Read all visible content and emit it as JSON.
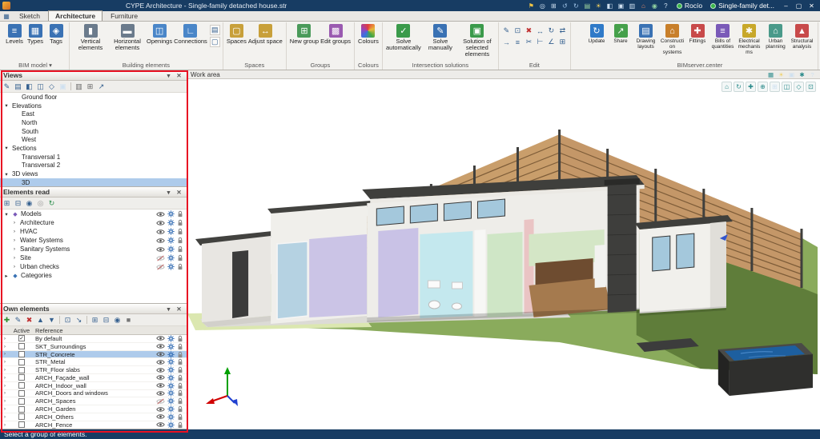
{
  "colors": {
    "titlebar": "#173c63",
    "selection": "#aecbeb",
    "annotation": "#e81123",
    "online_green": "#39b54a"
  },
  "titlebar": {
    "title": "CYPE Architecture - Single-family detached house.str",
    "quick_icons": [
      "flag-icon",
      "search-icon",
      "zoom-window-icon",
      "undo-icon",
      "redo-icon",
      "layers-icon",
      "sun-icon",
      "section-icon",
      "camera-icon",
      "printer-icon",
      "building-icon",
      "globe-icon",
      "help-icon"
    ],
    "user": "Rocío",
    "project": "Single-family det...",
    "window_buttons": [
      "minimize-button",
      "maximize-button",
      "close-button"
    ]
  },
  "tabs": [
    {
      "label": "Sketch",
      "active": false
    },
    {
      "label": "Architecture",
      "active": true
    },
    {
      "label": "Furniture",
      "active": false
    }
  ],
  "ribbon": {
    "groups": [
      {
        "label": "BIM model",
        "dropdown": true,
        "buttons": [
          {
            "label": "Levels",
            "icon": "levels-icon"
          },
          {
            "label": "Types",
            "icon": "types-icon"
          },
          {
            "label": "Tags",
            "icon": "tags-icon"
          }
        ]
      },
      {
        "label": "Building elements",
        "buttons": [
          {
            "label": "Vertical elements",
            "icon": "vertical-elements-icon"
          },
          {
            "label": "Horizontal elements",
            "icon": "horizontal-elements-icon"
          },
          {
            "label": "Openings",
            "icon": "openings-icon"
          },
          {
            "label": "Connections",
            "icon": "connections-icon"
          }
        ],
        "stack": [
          "wall-layers-icon",
          "frame-icon"
        ]
      },
      {
        "label": "Spaces",
        "buttons": [
          {
            "label": "Spaces",
            "icon": "spaces-icon"
          },
          {
            "label": "Adjust space",
            "icon": "adjust-space-icon"
          }
        ]
      },
      {
        "label": "Groups",
        "buttons": [
          {
            "label": "New group",
            "icon": "new-group-icon"
          },
          {
            "label": "Edit groups",
            "icon": "edit-groups-icon"
          }
        ]
      },
      {
        "label": "Colours",
        "buttons": [
          {
            "label": "Colours",
            "icon": "colours-icon"
          }
        ]
      },
      {
        "label": "Intersection solutions",
        "buttons": [
          {
            "label": "Solve automatically",
            "icon": "solve-auto-icon"
          },
          {
            "label": "Solve manually",
            "icon": "solve-manual-icon"
          },
          {
            "label": "Solution of selected elements",
            "icon": "solve-selected-icon"
          }
        ]
      },
      {
        "label": "Edit",
        "icons": [
          "edit-icon",
          "copy-icon",
          "delete-icon",
          "move-icon",
          "rotate-icon",
          "mirror-icon",
          "offset-icon",
          "align-icon",
          "trim-icon",
          "extend-icon",
          "measure-icon",
          "group-icon"
        ]
      },
      {
        "label": "BIMserver.center",
        "push": true,
        "compact": true,
        "buttons": [
          {
            "label": "Update",
            "icon": "update-icon"
          },
          {
            "label": "Share",
            "icon": "share-icon"
          },
          {
            "label": "Drawing layouts",
            "icon": "drawing-layouts-icon"
          },
          {
            "label": "Construction systems",
            "icon": "construction-systems-icon"
          },
          {
            "label": "Fittings",
            "icon": "fittings-icon"
          },
          {
            "label": "Bills of quantities",
            "icon": "bills-icon"
          },
          {
            "label": "Electrical mechanisms",
            "icon": "electrical-icon"
          },
          {
            "label": "Urban planning",
            "icon": "urban-planning-icon"
          },
          {
            "label": "Structural analysis",
            "icon": "structural-icon"
          }
        ]
      }
    ]
  },
  "views_panel": {
    "title": "Views",
    "toolbar": [
      "edit-view-icon",
      "floor-plan-icon",
      "elevation-icon",
      "section-view-icon",
      "view-3d-icon",
      "camera-icon",
      "sep",
      "print-icon",
      "layout-icon",
      "export-icon"
    ],
    "items": [
      {
        "label": "Ground floor",
        "level": 1
      },
      {
        "label": "Elevations",
        "level": 0,
        "expanded": true
      },
      {
        "label": "East",
        "level": 1
      },
      {
        "label": "North",
        "level": 1
      },
      {
        "label": "South",
        "level": 1
      },
      {
        "label": "West",
        "level": 1
      },
      {
        "label": "Sections",
        "level": 0,
        "expanded": true
      },
      {
        "label": "Transversal 1",
        "level": 1
      },
      {
        "label": "Transversal 2",
        "level": 1
      },
      {
        "label": "3D views",
        "level": 0,
        "expanded": true
      },
      {
        "label": "3D",
        "level": 1,
        "selected": true
      }
    ]
  },
  "elements_read_panel": {
    "title": "Elements read",
    "toolbar": [
      "expand-all-icon",
      "collapse-all-icon",
      "show-all-icon",
      "hide-all-icon",
      "refresh-icon"
    ],
    "items": [
      {
        "label": "Models",
        "level": 0,
        "expanded": true,
        "icon": "models-icon",
        "controls": true,
        "eye": true
      },
      {
        "label": "Architecture",
        "level": 1,
        "controls": true,
        "eye": true
      },
      {
        "label": "HVAC",
        "level": 1,
        "controls": true,
        "eye": true
      },
      {
        "label": "Water Systems",
        "level": 1,
        "controls": true,
        "eye": true
      },
      {
        "label": "Sanitary Systems",
        "level": 1,
        "controls": true,
        "eye": true
      },
      {
        "label": "Site",
        "level": 1,
        "controls": true,
        "eye": false
      },
      {
        "label": "Urban checks",
        "level": 1,
        "controls": true,
        "eye": false
      },
      {
        "label": "Categories",
        "level": 0,
        "expanded": false,
        "icon": "categories-icon",
        "controls": false
      }
    ]
  },
  "own_elements_panel": {
    "title": "Own elements",
    "toolbar": [
      "add-icon",
      "edit-icon",
      "delete-icon",
      "move-up-icon",
      "move-down-icon",
      "sep",
      "copy-icon",
      "import-icon",
      "sep",
      "expand-all-icon",
      "collapse-all-icon",
      "show-all-icon",
      "lock-all-icon"
    ],
    "columns": {
      "active": "Active",
      "reference": "Reference"
    },
    "rows": [
      {
        "reference": "By default",
        "active": true,
        "eye": true
      },
      {
        "reference": "SKT_Surroundings",
        "active": false,
        "eye": true
      },
      {
        "reference": "STR_Concrete",
        "active": false,
        "eye": true,
        "selected": true
      },
      {
        "reference": "STR_Metal",
        "active": false,
        "eye": true
      },
      {
        "reference": "STR_Floor slabs",
        "active": false,
        "eye": true
      },
      {
        "reference": "ARCH_Façade_wall",
        "active": false,
        "eye": true
      },
      {
        "reference": "ARCH_Indoor_wall",
        "active": false,
        "eye": true
      },
      {
        "reference": "ARCH_Doors and windows",
        "active": false,
        "eye": true
      },
      {
        "reference": "ARCH_Spaces",
        "active": false,
        "eye": false
      },
      {
        "reference": "ARCH_Garden",
        "active": false,
        "eye": true
      },
      {
        "reference": "ARCH_Others",
        "active": false,
        "eye": true
      },
      {
        "reference": "ARCH_Fence",
        "active": false,
        "eye": true
      }
    ]
  },
  "work_area": {
    "label": "Work area",
    "header_icons": [
      "display-icon",
      "sun-icon",
      "camera-icon",
      "settings-icon",
      "help-icon"
    ],
    "view_tools": [
      "home-icon",
      "orbit-icon",
      "pan-icon",
      "zoom-icon",
      "zoom-window-icon",
      "section-box-icon",
      "perspective-icon",
      "fullscreen-icon"
    ]
  },
  "statusbar": {
    "message": "Select a group of elements."
  }
}
